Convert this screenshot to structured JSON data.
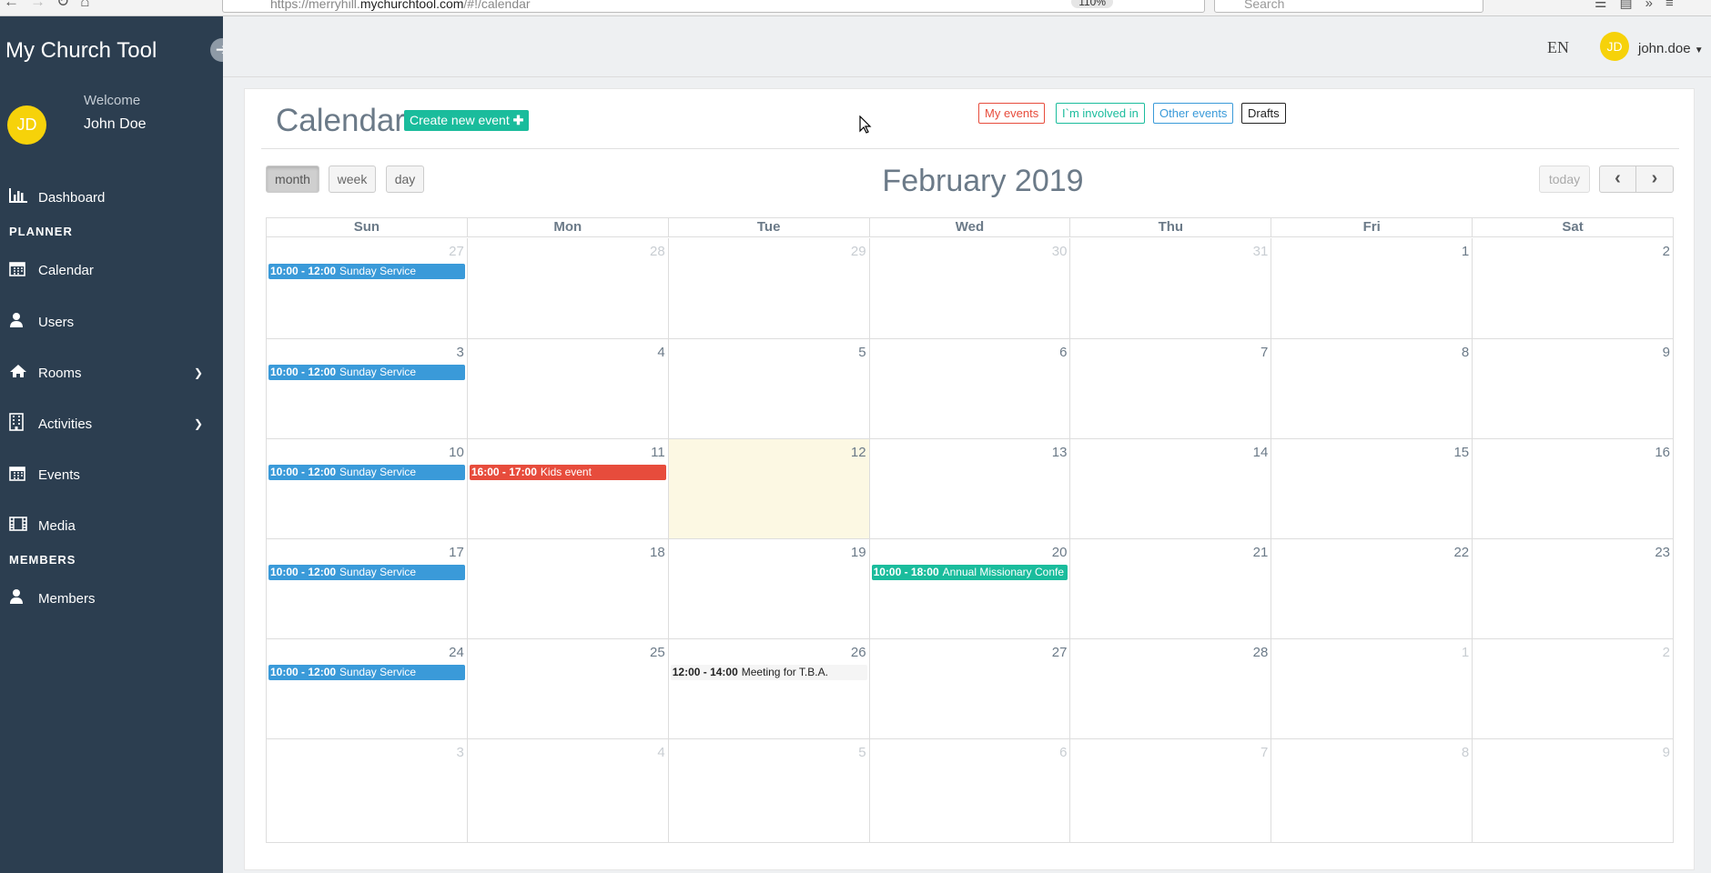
{
  "browser": {
    "url_prefix": "https://merryhill.",
    "url_domain": "mychurchtool.com",
    "url_path": "/#!/calendar",
    "zoom": "110%",
    "search_placeholder": "Search"
  },
  "sidebar": {
    "brand": "My Church Tool",
    "welcome": "Welcome",
    "user_name": "John Doe",
    "avatar_initials": "JD",
    "sections": {
      "planner": "PLANNER",
      "members": "MEMBERS"
    },
    "items": [
      {
        "label": "Dashboard",
        "icon": "bar-chart-icon"
      },
      {
        "label": "Calendar",
        "icon": "calendar-icon"
      },
      {
        "label": "Users",
        "icon": "user-icon"
      },
      {
        "label": "Rooms",
        "icon": "home-icon"
      },
      {
        "label": "Activities",
        "icon": "building-icon"
      },
      {
        "label": "Events",
        "icon": "calendar-icon"
      },
      {
        "label": "Media",
        "icon": "film-icon"
      },
      {
        "label": "Members",
        "icon": "user-icon"
      }
    ]
  },
  "header": {
    "language": "EN",
    "avatar_initials": "JD",
    "username": "john.doe"
  },
  "calendar": {
    "title": "Calendar",
    "create_button": "Create new event",
    "filters": {
      "my_events": "My events",
      "involved": "I`m involved in",
      "other": "Other events",
      "drafts": "Drafts"
    },
    "views": {
      "month": "month",
      "week": "week",
      "day": "day"
    },
    "active_view": "month",
    "month_label": "February 2019",
    "today_button": "today",
    "weekdays": [
      "Sun",
      "Mon",
      "Tue",
      "Wed",
      "Thu",
      "Fri",
      "Sat"
    ],
    "weeks": [
      [
        {
          "day": "27",
          "other": true,
          "events": [
            {
              "time": "10:00 - 12:00",
              "title": "Sunday Service",
              "color": "blue"
            }
          ]
        },
        {
          "day": "28",
          "other": true,
          "events": []
        },
        {
          "day": "29",
          "other": true,
          "events": []
        },
        {
          "day": "30",
          "other": true,
          "events": []
        },
        {
          "day": "31",
          "other": true,
          "events": []
        },
        {
          "day": "1",
          "other": false,
          "events": []
        },
        {
          "day": "2",
          "other": false,
          "events": []
        }
      ],
      [
        {
          "day": "3",
          "other": false,
          "events": [
            {
              "time": "10:00 - 12:00",
              "title": "Sunday Service",
              "color": "blue"
            }
          ]
        },
        {
          "day": "4",
          "other": false,
          "events": []
        },
        {
          "day": "5",
          "other": false,
          "events": []
        },
        {
          "day": "6",
          "other": false,
          "events": []
        },
        {
          "day": "7",
          "other": false,
          "events": []
        },
        {
          "day": "8",
          "other": false,
          "events": []
        },
        {
          "day": "9",
          "other": false,
          "events": []
        }
      ],
      [
        {
          "day": "10",
          "other": false,
          "events": [
            {
              "time": "10:00 - 12:00",
              "title": "Sunday Service",
              "color": "blue"
            }
          ]
        },
        {
          "day": "11",
          "other": false,
          "events": [
            {
              "time": "16:00 - 17:00",
              "title": "Kids event",
              "color": "red"
            }
          ]
        },
        {
          "day": "12",
          "other": false,
          "today": true,
          "events": []
        },
        {
          "day": "13",
          "other": false,
          "events": []
        },
        {
          "day": "14",
          "other": false,
          "events": []
        },
        {
          "day": "15",
          "other": false,
          "events": []
        },
        {
          "day": "16",
          "other": false,
          "events": []
        }
      ],
      [
        {
          "day": "17",
          "other": false,
          "events": [
            {
              "time": "10:00 - 12:00",
              "title": "Sunday Service",
              "color": "blue"
            }
          ]
        },
        {
          "day": "18",
          "other": false,
          "events": []
        },
        {
          "day": "19",
          "other": false,
          "events": []
        },
        {
          "day": "20",
          "other": false,
          "events": [
            {
              "time": "10:00 - 18:00",
              "title": "Annual Missionary Confe",
              "color": "green"
            }
          ]
        },
        {
          "day": "21",
          "other": false,
          "events": []
        },
        {
          "day": "22",
          "other": false,
          "events": []
        },
        {
          "day": "23",
          "other": false,
          "events": []
        }
      ],
      [
        {
          "day": "24",
          "other": false,
          "events": [
            {
              "time": "10:00 - 12:00",
              "title": "Sunday Service",
              "color": "blue"
            }
          ]
        },
        {
          "day": "25",
          "other": false,
          "events": []
        },
        {
          "day": "26",
          "other": false,
          "events": [
            {
              "time": "12:00 - 14:00",
              "title": "Meeting for T.B.A.",
              "color": "plain"
            }
          ]
        },
        {
          "day": "27",
          "other": false,
          "events": []
        },
        {
          "day": "28",
          "other": false,
          "events": []
        },
        {
          "day": "1",
          "other": true,
          "events": []
        },
        {
          "day": "2",
          "other": true,
          "events": []
        }
      ],
      [
        {
          "day": "3",
          "other": true,
          "events": []
        },
        {
          "day": "4",
          "other": true,
          "events": []
        },
        {
          "day": "5",
          "other": true,
          "events": []
        },
        {
          "day": "6",
          "other": true,
          "events": []
        },
        {
          "day": "7",
          "other": true,
          "events": []
        },
        {
          "day": "8",
          "other": true,
          "events": []
        },
        {
          "day": "9",
          "other": true,
          "events": []
        }
      ]
    ]
  },
  "colors": {
    "sidebar_bg": "#2c3e50",
    "accent_teal": "#1abc9c",
    "event_blue": "#3a9ad9",
    "event_red": "#e74c3c",
    "avatar_yellow": "#f6d20a",
    "today_bg": "#fcf8e3"
  }
}
